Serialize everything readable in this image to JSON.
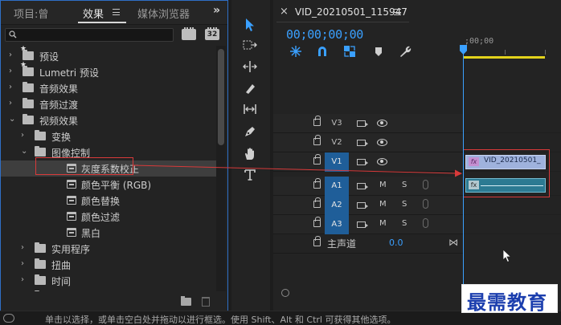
{
  "panel_tabs": {
    "project": "项目:曾",
    "effects": "效果",
    "media_browser": "媒体浏览器",
    "overflow": "»"
  },
  "search": {
    "value": "",
    "placeholder": ""
  },
  "preset_buttons": [
    "",
    "32"
  ],
  "effects_tree": [
    {
      "label": "预设",
      "chevron": "›",
      "icon": "star-folder-icon",
      "indent": 0
    },
    {
      "label": "Lumetri 预设",
      "chevron": "›",
      "icon": "star-folder-icon",
      "indent": 0
    },
    {
      "label": "音频效果",
      "chevron": "›",
      "icon": "folder-icon",
      "indent": 0
    },
    {
      "label": "音频过渡",
      "chevron": "›",
      "icon": "folder-icon",
      "indent": 0
    },
    {
      "label": "视频效果",
      "chevron": "⌄",
      "icon": "folder-icon",
      "indent": 0
    },
    {
      "label": "变换",
      "chevron": "›",
      "icon": "folder-icon",
      "indent": 1
    },
    {
      "label": "图像控制",
      "chevron": "⌄",
      "icon": "folder-icon",
      "indent": 1
    },
    {
      "label": "灰度系数校正",
      "chevron": "",
      "icon": "effect-icon",
      "indent": 2,
      "selected": true
    },
    {
      "label": "颜色平衡 (RGB)",
      "chevron": "",
      "icon": "effect-icon",
      "indent": 2
    },
    {
      "label": "颜色替换",
      "chevron": "",
      "icon": "effect-icon",
      "indent": 2
    },
    {
      "label": "颜色过滤",
      "chevron": "",
      "icon": "effect-icon",
      "indent": 2
    },
    {
      "label": "黑白",
      "chevron": "",
      "icon": "effect-icon",
      "indent": 2
    },
    {
      "label": "实用程序",
      "chevron": "›",
      "icon": "folder-icon",
      "indent": 1
    },
    {
      "label": "扭曲",
      "chevron": "›",
      "icon": "folder-icon",
      "indent": 1
    },
    {
      "label": "时间",
      "chevron": "›",
      "icon": "folder-icon",
      "indent": 1
    },
    {
      "label": "杂色与颗粒",
      "chevron": "›",
      "icon": "folder-icon",
      "indent": 1
    }
  ],
  "tools": [
    "selection-tool",
    "track-select-tool",
    "ripple-edit-tool",
    "razor-tool",
    "slip-tool",
    "pen-tool",
    "hand-tool",
    "type-tool"
  ],
  "sequence": {
    "close": "×",
    "name": "VID_20210501_115947",
    "timecode": "00;00;00;00",
    "ruler_label": ";00;00"
  },
  "tracks": [
    {
      "name": "V3",
      "targeted": false,
      "kind": "video"
    },
    {
      "name": "V2",
      "targeted": false,
      "kind": "video"
    },
    {
      "name": "V1",
      "targeted": true,
      "kind": "video"
    },
    {
      "name": "A1",
      "targeted": true,
      "kind": "audio"
    },
    {
      "name": "A2",
      "targeted": true,
      "kind": "audio"
    },
    {
      "name": "A3",
      "targeted": true,
      "kind": "audio"
    }
  ],
  "audio_buttons": {
    "mute": "M",
    "solo": "S"
  },
  "master": {
    "label": "主声道",
    "value": "0.0",
    "end_icon": "⋈"
  },
  "clips": {
    "video_name": "VID_20210501_",
    "video_fx": "fx",
    "audio_fx": "fx"
  },
  "status_text": "单击以选择，或单击空白处并拖动以进行框选。使用 Shift、Alt 和 Ctrl 可获得其他选项。",
  "watermark": "最需教育",
  "colors": {
    "accent_blue": "#3aa0ff",
    "panel_focus_border": "#2f6fc6",
    "annotation_red": "#d83a3a",
    "work_area_yellow": "#e3d31c",
    "video_clip": "#9fb2dd",
    "audio_clip": "#2c7a92"
  }
}
